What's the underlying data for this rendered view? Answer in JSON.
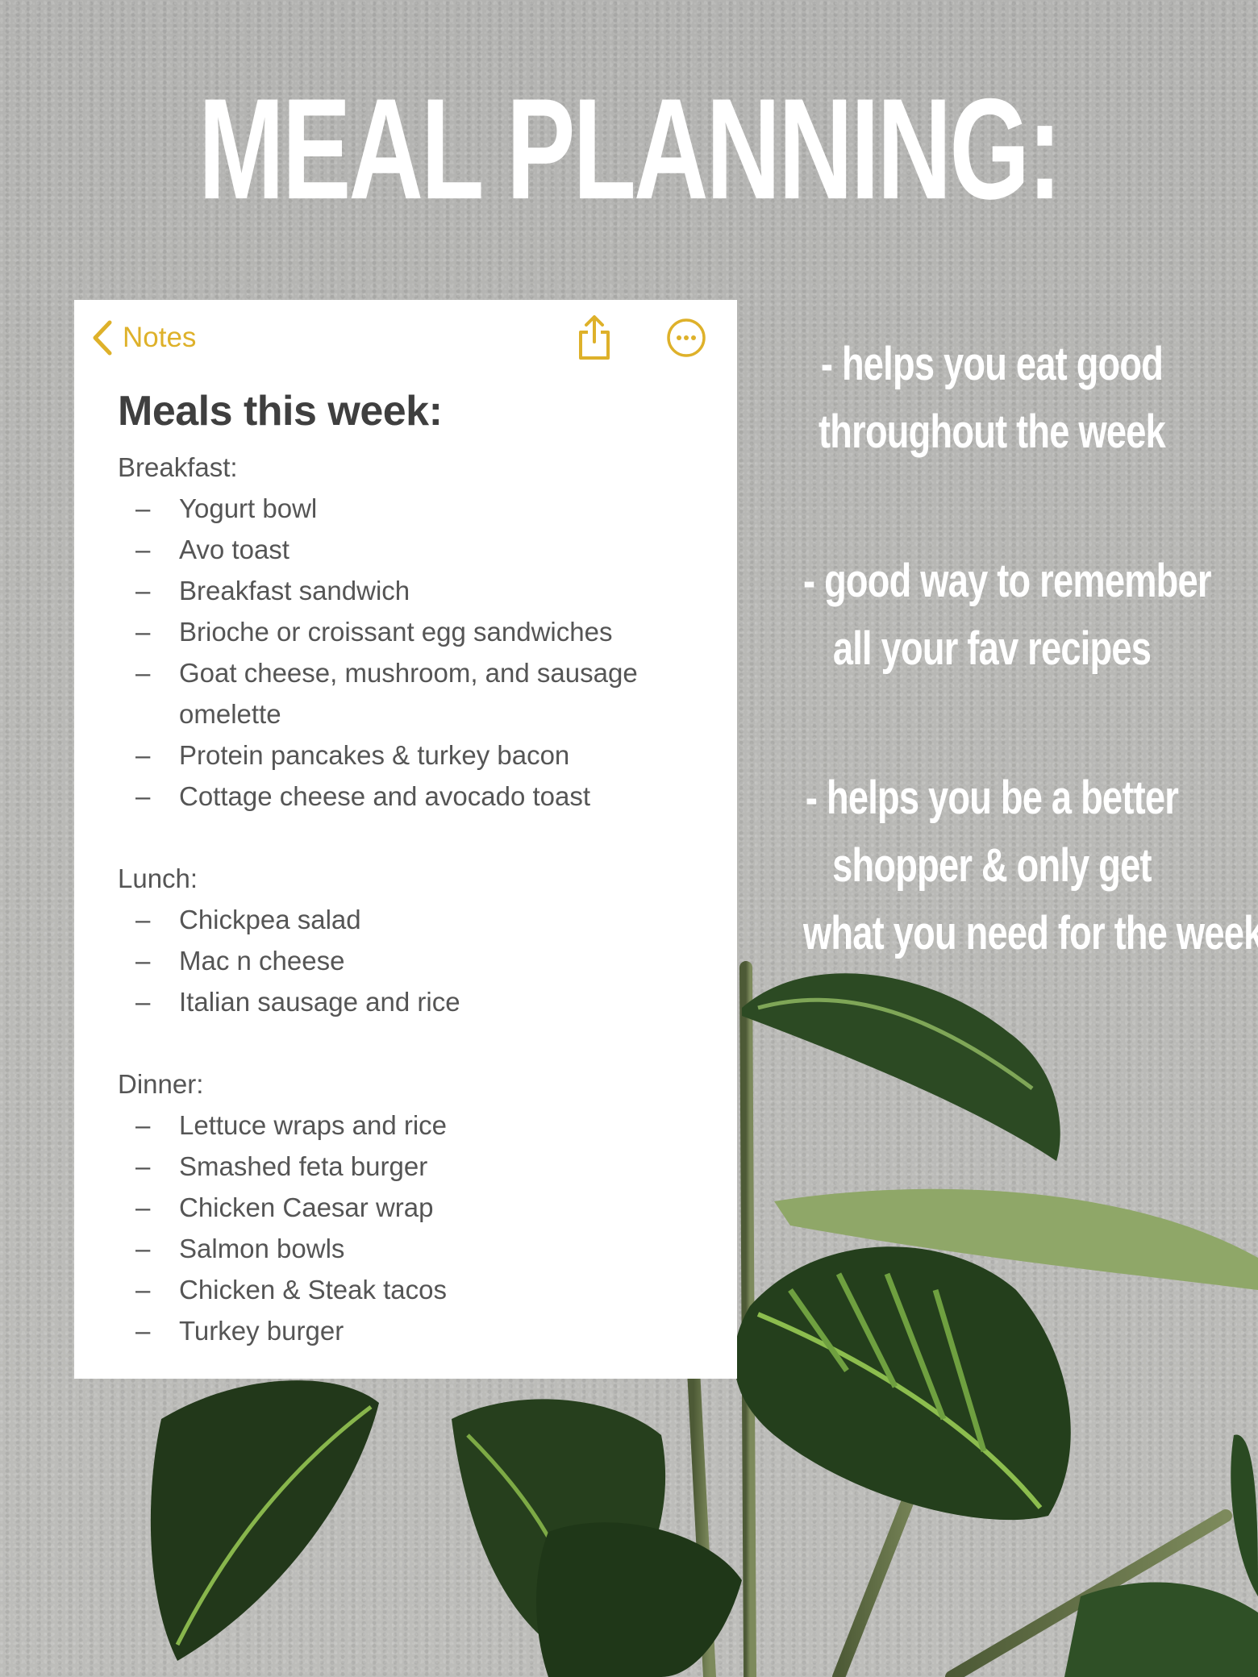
{
  "poster": {
    "title": "MEAL PLANNING:",
    "text_color": "#ffffff",
    "accent_color": "#e0b12a",
    "benefits": [
      {
        "lines": [
          "- helps you eat good",
          "throughout the week"
        ]
      },
      {
        "lines": [
          "- good way to remember",
          "all your fav recipes"
        ]
      },
      {
        "lines": [
          "- helps you be a better",
          "shopper & only get",
          "what you need for the week"
        ]
      }
    ]
  },
  "notes_app": {
    "nav": {
      "back_label": "Notes",
      "back_icon": "chevron-left-icon",
      "share_icon": "share-icon",
      "more_icon": "ellipsis-circle-icon"
    },
    "note": {
      "title": "Meals this week:",
      "sections": [
        {
          "heading": "Breakfast:",
          "items": [
            "Yogurt bowl",
            "Avo toast",
            "Breakfast sandwich",
            "Brioche or croissant egg sandwiches",
            "Goat cheese, mushroom, and sausage omelette",
            "Protein pancakes & turkey bacon",
            "Cottage cheese and avocado toast"
          ]
        },
        {
          "heading": "Lunch:",
          "items": [
            "Chickpea salad",
            "Mac n cheese",
            "Italian sausage and rice"
          ]
        },
        {
          "heading": "Dinner:",
          "items": [
            "Lettuce wraps and rice",
            "Smashed feta burger",
            "Chicken Caesar wrap",
            "Salmon bowls",
            "Chicken & Steak tacos",
            "Turkey burger"
          ]
        }
      ],
      "bullet": "–"
    }
  }
}
